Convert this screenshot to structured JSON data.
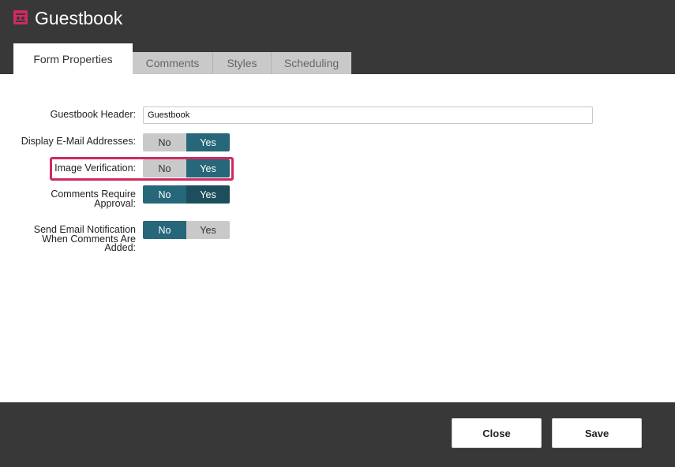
{
  "window": {
    "title": "Guestbook",
    "logo_icon": "guestbook-logo-icon",
    "brand_color": "#cf2a5f"
  },
  "tabs": [
    {
      "label": "Form Properties",
      "active": true
    },
    {
      "label": "Comments",
      "active": false
    },
    {
      "label": "Styles",
      "active": false
    },
    {
      "label": "Scheduling",
      "active": false
    }
  ],
  "form": {
    "header_label": "Guestbook Header:",
    "header_value": "Guestbook",
    "rows": [
      {
        "label": "Display E-Mail Addresses:",
        "no": "No",
        "yes": "Yes",
        "selected": "Yes"
      },
      {
        "label": "Image Verification:",
        "no": "No",
        "yes": "Yes",
        "selected": "Yes",
        "highlighted": true
      },
      {
        "label_line1": "Comments Require",
        "label_line2": "Approval:",
        "no": "No",
        "yes": "Yes",
        "selected": "Yes"
      },
      {
        "label_line1": "Send Email Notification",
        "label_line2": "When Comments Are",
        "label_line3": "Added:",
        "no": "No",
        "yes": "Yes",
        "selected": "No"
      }
    ]
  },
  "colors": {
    "toggle_on": "#27677a",
    "toggle_off": "#c9c9c9",
    "header_bg": "#383838",
    "highlight": "#cf2a5f"
  },
  "footer": {
    "close_label": "Close",
    "save_label": "Save"
  }
}
